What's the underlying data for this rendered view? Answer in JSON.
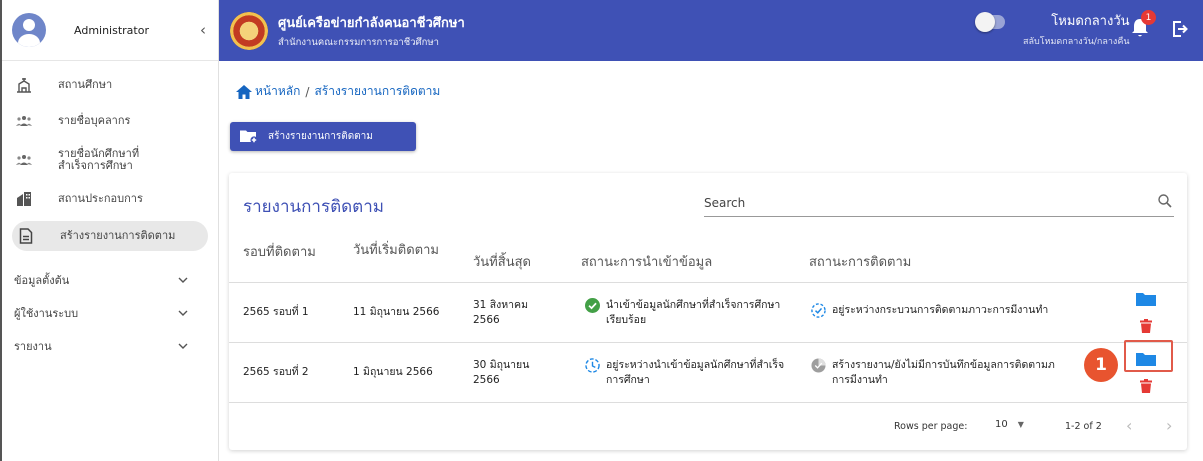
{
  "sidebar": {
    "user_name": "Administrator",
    "collapse_icon": "chevron-left-icon",
    "items": [
      {
        "label": "สถานศึกษา",
        "icon": "school-icon"
      },
      {
        "label": "รายชื่อบุคลากร",
        "icon": "people-icon"
      },
      {
        "label": "รายชื่อนักศึกษาที่สำเร็จการศึกษา",
        "icon": "people-icon"
      },
      {
        "label": "สถานประกอบการ",
        "icon": "building-icon"
      },
      {
        "label": "สร้างรายงานการติดตาม",
        "icon": "document-icon"
      }
    ],
    "groups": [
      {
        "label": "ข้อมูลตั้งต้น"
      },
      {
        "label": "ผู้ใช้งานระบบ"
      },
      {
        "label": "รายงาน"
      }
    ]
  },
  "header": {
    "title": "ศูนย์เครือข่ายกำลังคนอาชีวศึกษา",
    "subtitle": "สำนักงานคณะกรรมการการอาชีวศึกษา",
    "mode_label": "โหมดกลางวัน",
    "mode_sub": "สลับโหมดกลางวัน/กลางคืน",
    "notification_count": "1",
    "accent": "#3f51b5"
  },
  "breadcrumb": {
    "home": "หน้าหลัก",
    "separator": "/",
    "current": "สร้างรายงานการติดตาม"
  },
  "create_button": "สร้างรายงานการติดตาม",
  "card": {
    "title": "รายงานการติดตาม",
    "search_placeholder": "Search",
    "columns": [
      "รอบที่ติดตาม",
      "วันที่เริ่มติดตาม",
      "วันที่สิ้นสุด",
      "สถานะการนำเข้าข้อมูล",
      "สถานะการติดตาม"
    ],
    "rows": [
      {
        "round": "2565 รอบที่ 1",
        "start": "11 มิถุนายน 2566",
        "end_line1": "31 สิงหาคม",
        "end_line2": "2566",
        "import_line1": "นำเข้าข้อมูลนักศึกษาที่สำเร็จการศึกษา",
        "import_line2": "เรียบร้อย",
        "track_line1": "อยู่ระหว่างกระบวนการติดตามภาวะการมีงานทำ",
        "track_line2": ""
      },
      {
        "round": "2565 รอบที่ 2",
        "start": "1 มิถุนายน 2566",
        "end_line1": "30 มิถุนายน",
        "end_line2": "2566",
        "import_line1": "อยู่ระหว่างนำเข้าข้อมูลนักศึกษาที่สำเร็จ",
        "import_line2": "การศึกษา",
        "track_line1": "สร้างรายงาน/ยังไม่มีการบันทึกข้อมูลการติดตามภ",
        "track_line2": "การมีงานทำ"
      }
    ],
    "footer": {
      "rows_per_page_label": "Rows per page:",
      "rows_per_page_value": "10",
      "range": "1-2 of 2"
    }
  },
  "annotation": {
    "marker": "1",
    "color": "#e8542f"
  }
}
